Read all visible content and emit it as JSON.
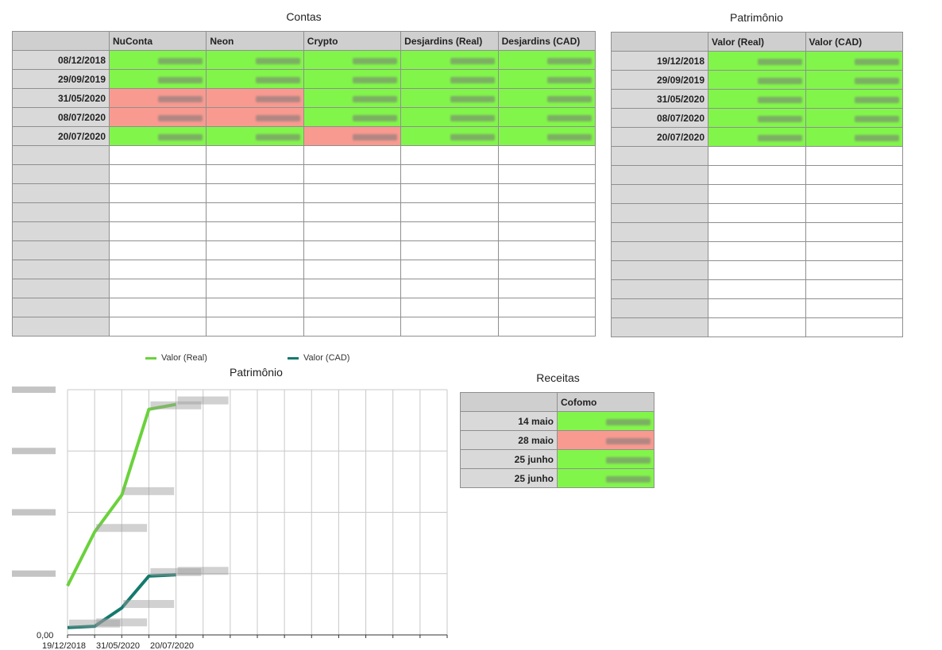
{
  "contas": {
    "title": "Contas",
    "columns": [
      "",
      "NuConta",
      "Neon",
      "Crypto",
      "Desjardins (Real)",
      "Desjardins (CAD)"
    ],
    "rows": [
      {
        "date": "08/12/2018",
        "cells": [
          {
            "status": "green"
          },
          {
            "status": "green"
          },
          {
            "status": "green"
          },
          {
            "status": "green"
          },
          {
            "status": "green"
          }
        ]
      },
      {
        "date": "29/09/2019",
        "cells": [
          {
            "status": "green"
          },
          {
            "status": "green"
          },
          {
            "status": "green"
          },
          {
            "status": "green"
          },
          {
            "status": "green"
          }
        ]
      },
      {
        "date": "31/05/2020",
        "cells": [
          {
            "status": "red"
          },
          {
            "status": "red"
          },
          {
            "status": "green"
          },
          {
            "status": "green"
          },
          {
            "status": "green"
          }
        ]
      },
      {
        "date": "08/07/2020",
        "cells": [
          {
            "status": "red"
          },
          {
            "status": "red"
          },
          {
            "status": "green"
          },
          {
            "status": "green"
          },
          {
            "status": "green"
          }
        ]
      },
      {
        "date": "20/07/2020",
        "cells": [
          {
            "status": "green"
          },
          {
            "status": "green"
          },
          {
            "status": "red"
          },
          {
            "status": "green"
          },
          {
            "status": "green"
          }
        ]
      }
    ],
    "empty_rows": 10
  },
  "patrimonio_table": {
    "title": "Patrimônio",
    "columns": [
      "",
      "Valor (Real)",
      "Valor (CAD)"
    ],
    "rows": [
      {
        "date": "19/12/2018",
        "cells": [
          {
            "status": "green"
          },
          {
            "status": "green"
          }
        ]
      },
      {
        "date": "29/09/2019",
        "cells": [
          {
            "status": "green"
          },
          {
            "status": "green"
          }
        ]
      },
      {
        "date": "31/05/2020",
        "cells": [
          {
            "status": "green"
          },
          {
            "status": "green"
          }
        ]
      },
      {
        "date": "08/07/2020",
        "cells": [
          {
            "status": "green"
          },
          {
            "status": "green"
          }
        ]
      },
      {
        "date": "20/07/2020",
        "cells": [
          {
            "status": "green"
          },
          {
            "status": "green"
          }
        ]
      }
    ],
    "empty_rows": 10
  },
  "receitas": {
    "title": "Receitas",
    "columns": [
      "",
      "Cofomo"
    ],
    "rows": [
      {
        "label": "14 maio",
        "status": "green"
      },
      {
        "label": "28 maio",
        "status": "red"
      },
      {
        "label": "25 junho",
        "status": "green"
      },
      {
        "label": "25 junho",
        "status": "green"
      }
    ]
  },
  "chart_data": {
    "type": "line",
    "title": "Patrimônio",
    "legend": [
      "Valor (Real)",
      "Valor (CAD)"
    ],
    "legend_placement": "top",
    "x_ticks": [
      "19/12/2018",
      "31/05/2020",
      "20/07/2020"
    ],
    "y_zero_label": "0,00",
    "grid": true,
    "series": [
      {
        "name": "Valor (Real)",
        "color": "#6ad23c",
        "values": [
          0.2,
          0.42,
          0.57,
          0.92,
          0.94
        ]
      },
      {
        "name": "Valor (CAD)",
        "color": "#137a6d",
        "values": [
          0.03,
          0.035,
          0.11,
          0.24,
          0.245
        ]
      }
    ]
  },
  "colors": {
    "green": "#82f54b",
    "red": "#f99a90",
    "header": "#cfcfcf"
  }
}
